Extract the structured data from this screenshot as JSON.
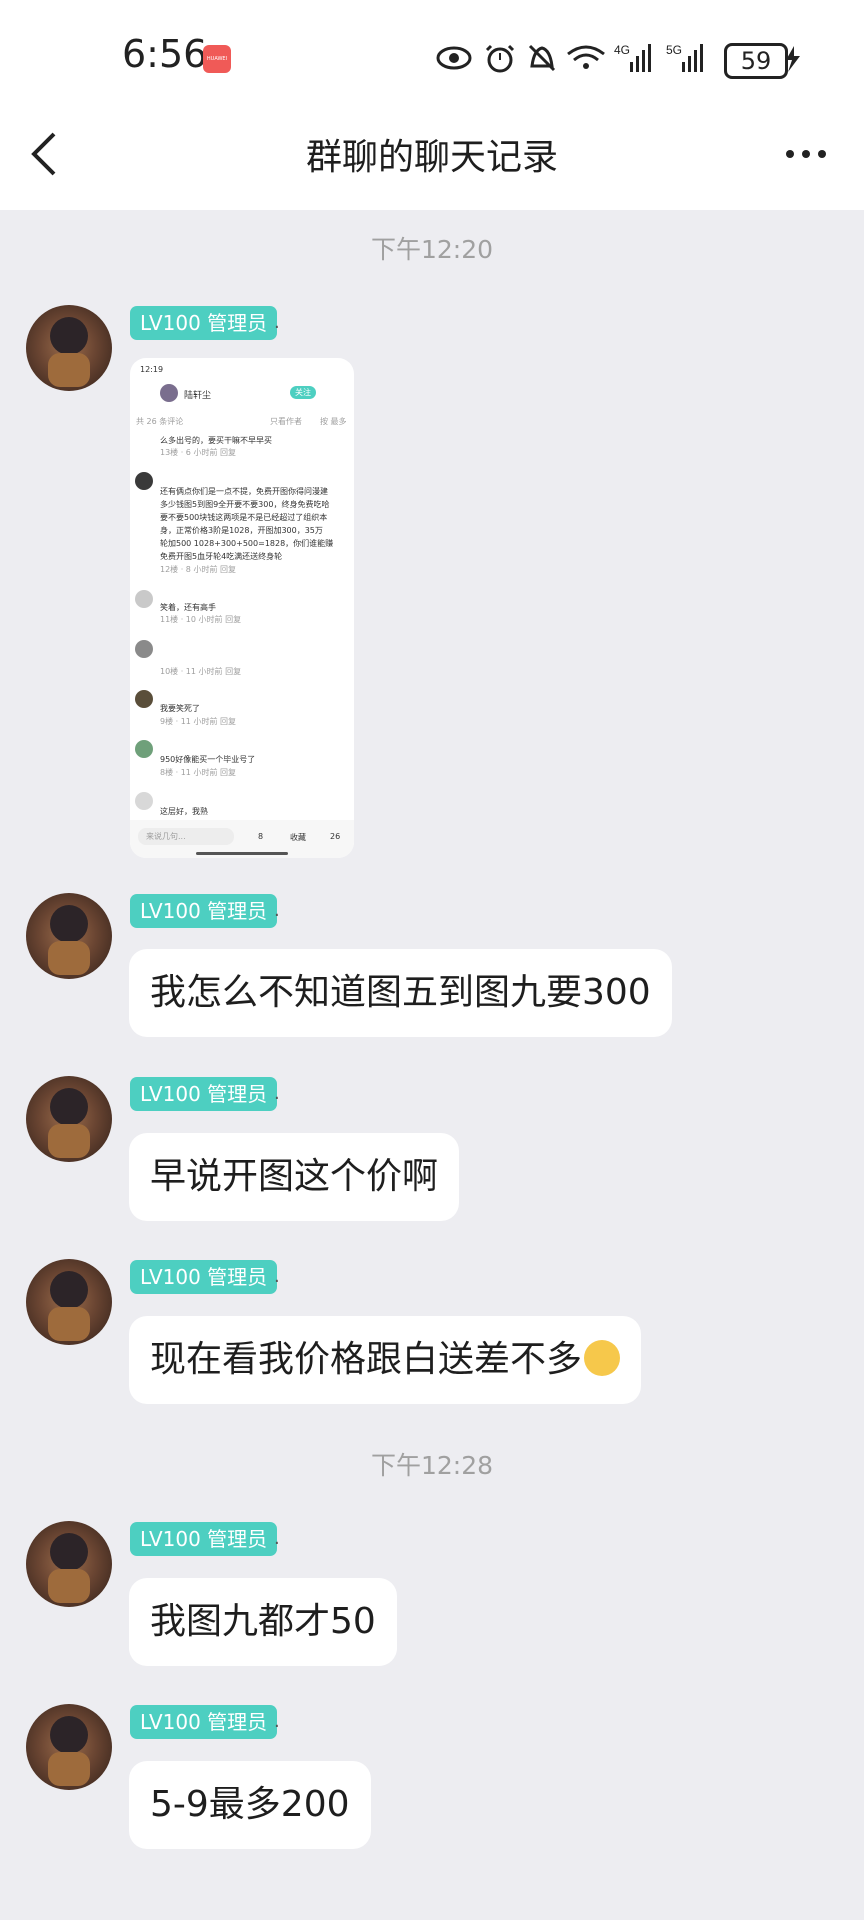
{
  "status_bar": {
    "time": "6:56",
    "huawei_badge": "HUAWEI",
    "network_4g": "4G",
    "network_5g": "5G",
    "battery": "59"
  },
  "header": {
    "title": "群聊的聊天记录"
  },
  "timestamps": [
    "下午12:20",
    "下午12:28"
  ],
  "sender": {
    "tag": "LV100 管理员",
    "suffix": "."
  },
  "messages": [
    {
      "type": "image"
    },
    {
      "type": "text",
      "text": "我怎么不知道图五到图九要300"
    },
    {
      "type": "text",
      "text": "早说开图这个价啊"
    },
    {
      "type": "text",
      "text": "现在看我价格跟白送差不多",
      "emoji": "smirk-emoji"
    },
    {
      "type": "text",
      "text": "我图九都才50"
    },
    {
      "type": "text",
      "text": "5-9最多200"
    }
  ],
  "image_content": {
    "time": "12:19",
    "name": "陆轩尘",
    "follow": "关注",
    "comments_count": "共 26 条评论",
    "only_author": "只看作者",
    "sort": "按 最多",
    "lines": [
      "么多出号的，要买干嘛不早早买",
      "13楼 · 6 小时前  回复",
      "还有俩点你们是一点不提，免费开图你得问漫建",
      "多少钱图5到图9全开要不要300，终身免费吃哈",
      "要不要500块钱这两项是不是已经超过了组织本",
      "身，正常价格3阶是1028，开图加300，35万",
      "轮加500  1028+300+500=1828，你们谁能赚",
      "免费开图5血牙轮4吃满还送终身轮",
      "12楼 · 8 小时前  回复",
      "笑着，还有高手",
      "11楼 · 10 小时前  回复",
      "10楼 · 11 小时前  回复",
      "我要笑死了",
      "9楼 · 11 小时前  回复",
      "950好像能买一个毕业号了",
      "8楼 · 11 小时前  回复",
      "这层好，我熟"
    ],
    "input_placeholder": "来说几句...",
    "likes": "8",
    "collect": "收藏",
    "comments": "26"
  }
}
